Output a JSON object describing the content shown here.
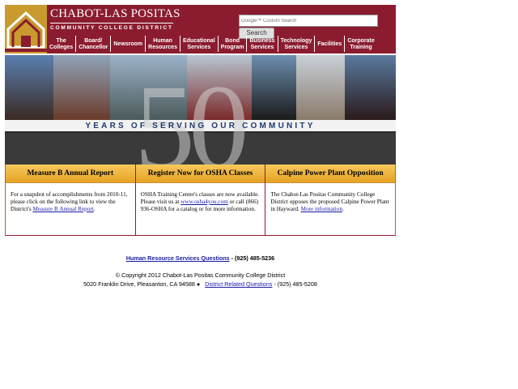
{
  "header": {
    "title": "CHABOT-LAS POSITAS",
    "subtitle": "COMMUNITY COLLEGE DISTRICT",
    "search_placeholder": "Google™ Custom Search",
    "search_button": "Search"
  },
  "nav": [
    {
      "line1": "The",
      "line2": "Colleges"
    },
    {
      "line1": "Board/",
      "line2": "Chancellor"
    },
    {
      "line1": "Newsroom",
      "line2": ""
    },
    {
      "line1": "Human",
      "line2": "Resources"
    },
    {
      "line1": "Educational",
      "line2": "Services"
    },
    {
      "line1": "Bond",
      "line2": "Program"
    },
    {
      "line1": "Business",
      "line2": "Services"
    },
    {
      "line1": "Technology",
      "line2": "Services"
    },
    {
      "line1": "Facilities",
      "line2": ""
    },
    {
      "line1": "Corporate",
      "line2": "Training"
    }
  ],
  "banner": {
    "tagline": "YEARS OF SERVING OUR COMMUNITY",
    "big_number": "50"
  },
  "columns": [
    {
      "heading": "Measure B Annual Report",
      "text_before": "For a snapshot of accomplishments from 2010-11, please click on the following link to view the District's ",
      "link": "Measure B Annual Report",
      "text_after": "."
    },
    {
      "heading": "Register Now for OSHA Classes",
      "text_before": "OSHA Training Center's classes are now available. Please visit us at ",
      "link": "www.osha4you.com",
      "text_after": " or call (866) 936-OSHA for a catalog or for more information."
    },
    {
      "heading": "Calpine Power Plant Opposition",
      "text_before": "The Chabot-Las Positas Community College District opposes the proposed Calpine Power Plant in Hayward. ",
      "link": "More information",
      "text_after": "."
    }
  ],
  "footer": {
    "hr_link": "Human Resource Services Questions",
    "hr_phone": " - (925) 485-5236",
    "copyright": "© Copyright 2012 Chabot-Las Positas Community College District",
    "address": "5020 Franklin Drive, Pleasanton, CA 94588 ●",
    "district_link": "District Related Questions",
    "district_phone": " - (925) 485-5208"
  },
  "colors": {
    "brand_maroon": "#8b1c30",
    "brand_gold": "#c99a2e",
    "link_blue": "#1a1aa6",
    "tagline_navy": "#1f3a6b"
  }
}
